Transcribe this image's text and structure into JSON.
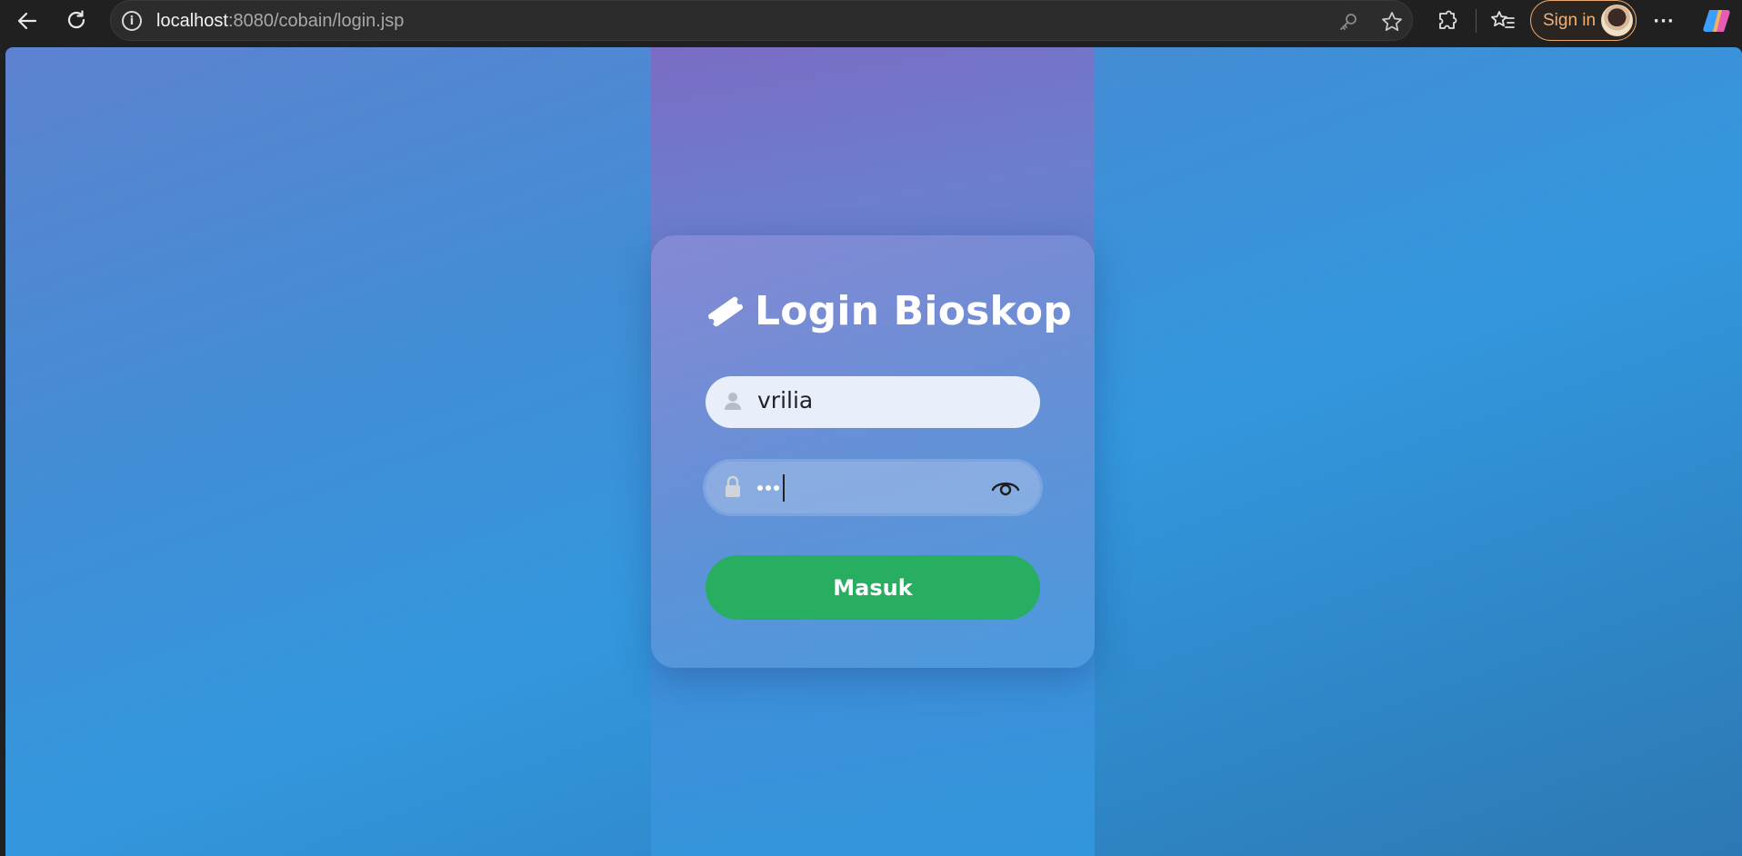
{
  "browser": {
    "url_host": "localhost",
    "url_path": ":8080/cobain/login.jsp",
    "signin_label": "Sign in",
    "accent_color": "#f0b27a"
  },
  "login": {
    "title": "Login Bioskop",
    "title_icon": "ticket-icon",
    "username_value": "vrilia",
    "password_mask_count": 3,
    "submit_label": "Masuk",
    "submit_color": "#27ae60"
  }
}
